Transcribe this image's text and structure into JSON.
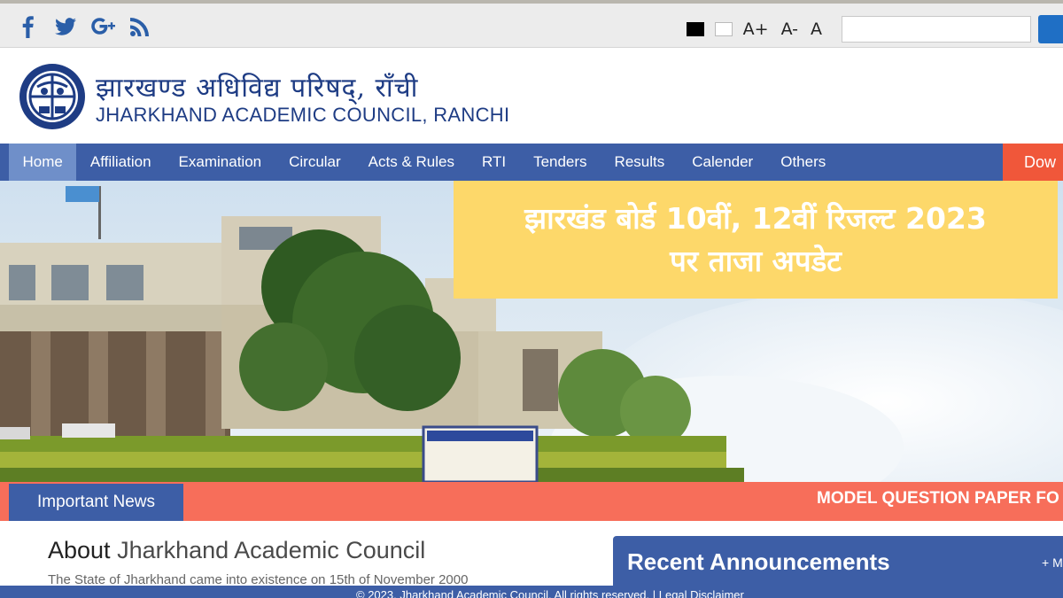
{
  "utility": {
    "social": [
      "facebook",
      "twitter",
      "google-plus",
      "rss"
    ],
    "font_increase": "A+",
    "font_decrease": "A-",
    "font_reset": "A",
    "search_value": ""
  },
  "header": {
    "title_hindi": "झारखण्ड अधिविद्य परिषद्, राँची",
    "title_english": "JHARKHAND ACADEMIC COUNCIL, RANCHI"
  },
  "nav": {
    "items": [
      "Home",
      "Affiliation",
      "Examination",
      "Circular",
      "Acts & Rules",
      "RTI",
      "Tenders",
      "Results",
      "Calender",
      "Others"
    ],
    "download_label": "Dow"
  },
  "promo": {
    "line1": "झारखंड बोर्ड  10वीं, 12वीं रिजल्ट 2023",
    "line2": "पर ताजा अपडेट"
  },
  "news": {
    "label": "Important News",
    "ticker": "MODEL QUESTION PAPER FO"
  },
  "about": {
    "title_prefix": "About ",
    "title_highlight": "Jharkhand Academic Council",
    "text": "The State of Jharkhand came into existence on 15th of November 2000"
  },
  "announcements": {
    "title": "Recent Announcements",
    "more": "+ M"
  },
  "footer": {
    "text": "© 2023, Jharkhand Academic Council. All rights reserved. | Legal Disclaimer"
  },
  "colors": {
    "nav_bg": "#3d5ea6",
    "nav_active": "#6f8fc9",
    "accent_red": "#f76e5a",
    "promo_yellow": "#fdd86a",
    "title_blue": "#1e3c84"
  }
}
